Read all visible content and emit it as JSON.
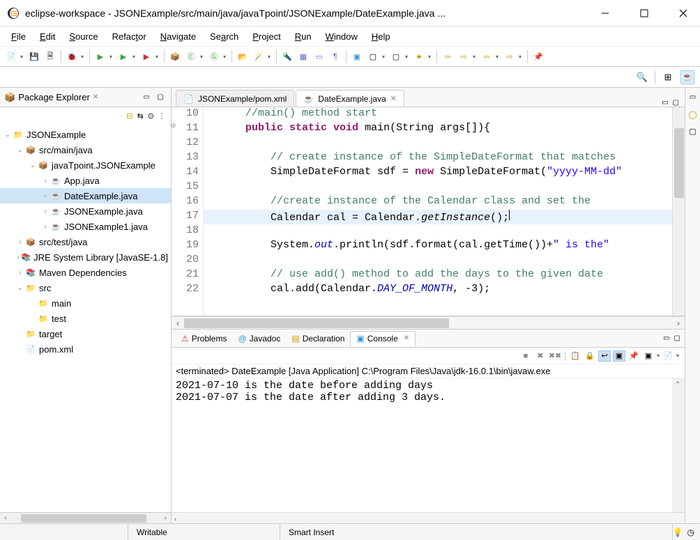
{
  "window": {
    "title": "eclipse-workspace - JSONExample/src/main/java/javaTpoint/JSONExample/DateExample.java ..."
  },
  "menu": {
    "file": "File",
    "edit": "Edit",
    "source": "Source",
    "refactor": "Refactor",
    "navigate": "Navigate",
    "search": "Search",
    "project": "Project",
    "run": "Run",
    "window": "Window",
    "help": "Help"
  },
  "package_explorer": {
    "title": "Package Explorer",
    "project": "JSONExample",
    "src_main": "src/main/java",
    "package": "javaTpoint.JSONExample",
    "files": {
      "app": "App.java",
      "date_example": "DateExample.java",
      "json_example": "JSONExample.java",
      "json_example1": "JSONExample1.java"
    },
    "src_test": "src/test/java",
    "jre": "JRE System Library [JavaSE-1.8]",
    "maven_deps": "Maven Dependencies",
    "src_folder": "src",
    "main_folder": "main",
    "test_folder": "test",
    "target": "target",
    "pom": "pom.xml"
  },
  "editor": {
    "tabs": {
      "pom": "JSONExample/pom.xml",
      "date": "DateExample.java"
    },
    "lines": {
      "l10": "10",
      "l11": "11",
      "l12": "12",
      "l13": "13",
      "l14": "14",
      "l15": "15",
      "l16": "16",
      "l17": "17",
      "l18": "18",
      "l19": "19",
      "l20": "20",
      "l21": "21",
      "l22": "22"
    },
    "code": {
      "c10": "//main() method start",
      "c11_public": "public ",
      "c11_static": "static ",
      "c11_void": "void",
      "c11_main": " main(String args[]){",
      "c13": "// create instance of the SimpleDateFormat that matches",
      "c14a": "SimpleDateFormat sdf = ",
      "c14_new": "new",
      "c14b": " SimpleDateFormat(",
      "c14_str": "\"yyyy-MM-dd\"",
      "c16": "//create instance of the Calendar class and set the",
      "c17a": "Calendar cal = Calendar.",
      "c17b": "getInstance",
      "c17c": "();",
      "c19a": "System.",
      "c19_out": "out",
      "c19b": ".println(sdf.format(cal.getTime())+",
      "c19_str": "\" is the\"",
      "c21": "// use add() method to add the days to the given date",
      "c22a": "cal.add(Calendar.",
      "c22b": "DAY_OF_MONTH",
      "c22c": ", -3);"
    }
  },
  "bottom": {
    "tabs": {
      "problems": "Problems",
      "javadoc": "Javadoc",
      "declaration": "Declaration",
      "console": "Console"
    },
    "console_header": "<terminated> DateExample [Java Application] C:\\Program Files\\Java\\jdk-16.0.1\\bin\\javaw.exe",
    "console_line1": "2021-07-10 is the date before adding days",
    "console_line2": "2021-07-07 is the date after adding 3 days."
  },
  "status": {
    "writable": "Writable",
    "insert": "Smart Insert"
  }
}
